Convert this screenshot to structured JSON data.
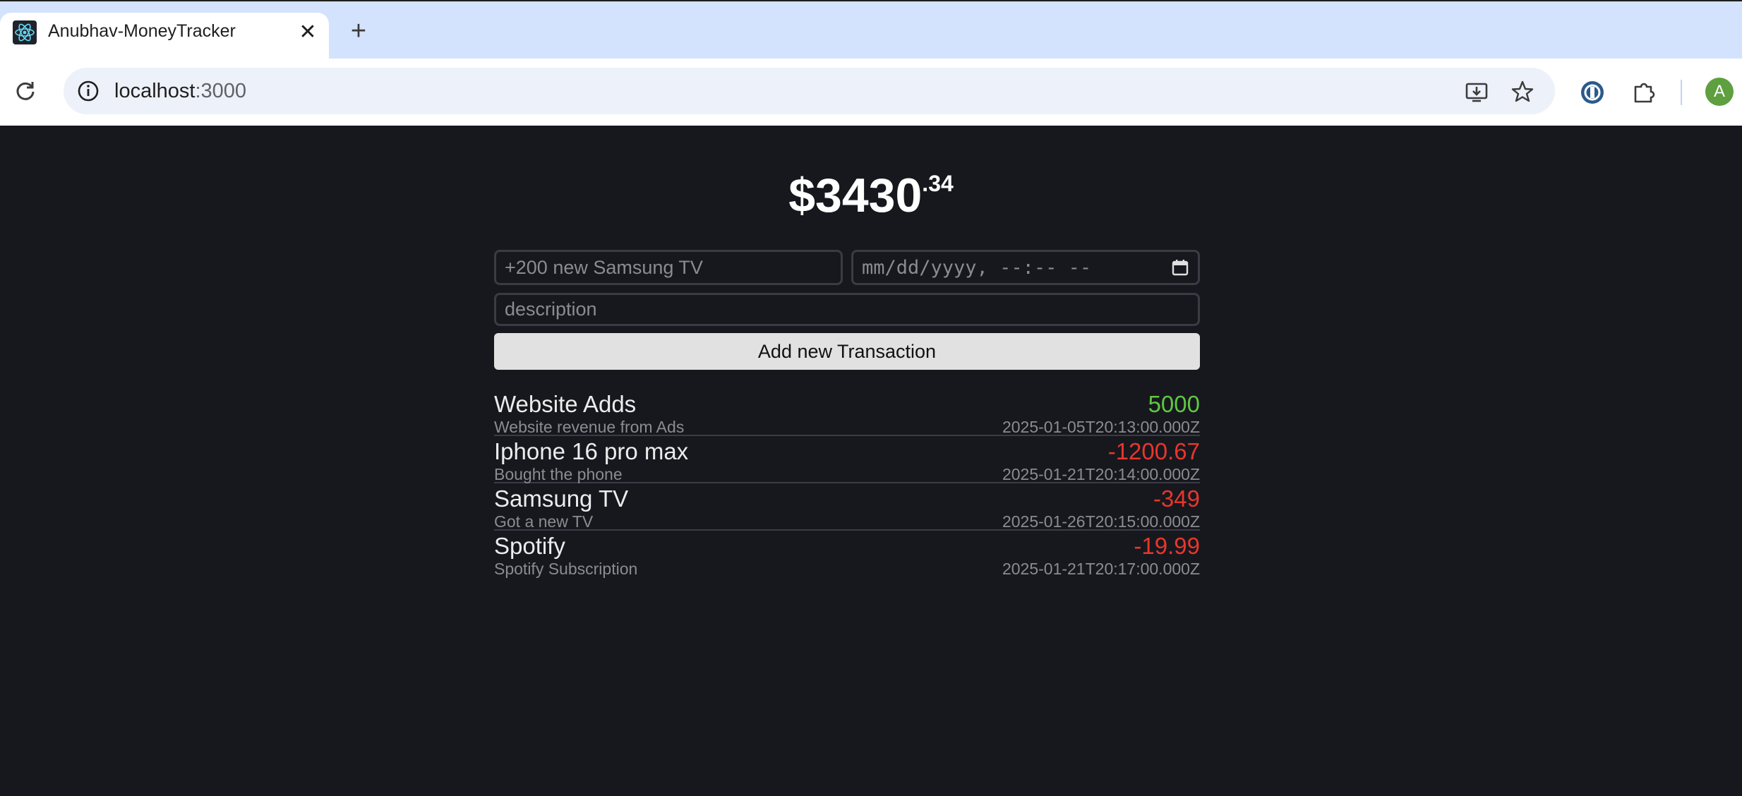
{
  "browser": {
    "tab_title": "Anubhav-MoneyTracker",
    "tab_close": "✕",
    "new_tab": "+",
    "url_host": "localhost",
    "url_port": ":3000",
    "avatar_letter": "A"
  },
  "app": {
    "balance_main": "$3430",
    "balance_cents": ".34",
    "name_placeholder": "+200 new Samsung TV",
    "date_placeholder": "mm/dd/yyyy, --:-- --",
    "description_placeholder": "description",
    "add_button_label": "Add new Transaction",
    "transactions": [
      {
        "name": "Website Adds",
        "amount": "5000",
        "description": "Website revenue from Ads",
        "datetime": "2025-01-05T20:13:00.000Z",
        "color": "#5fc742"
      },
      {
        "name": "Iphone 16 pro max",
        "amount": "-1200.67",
        "description": "Bought the phone",
        "datetime": "2025-01-21T20:14:00.000Z",
        "color": "#e8362c"
      },
      {
        "name": "Samsung TV",
        "amount": "-349",
        "description": "Got a new TV",
        "datetime": "2025-01-26T20:15:00.000Z",
        "color": "#e8362c"
      },
      {
        "name": "Spotify",
        "amount": "-19.99",
        "description": "Spotify Subscription",
        "datetime": "2025-01-21T20:17:00.000Z",
        "color": "#e8362c"
      }
    ]
  },
  "colors": {
    "page_bg": "#17181e",
    "positive": "#5fc742",
    "negative": "#e8362c"
  }
}
